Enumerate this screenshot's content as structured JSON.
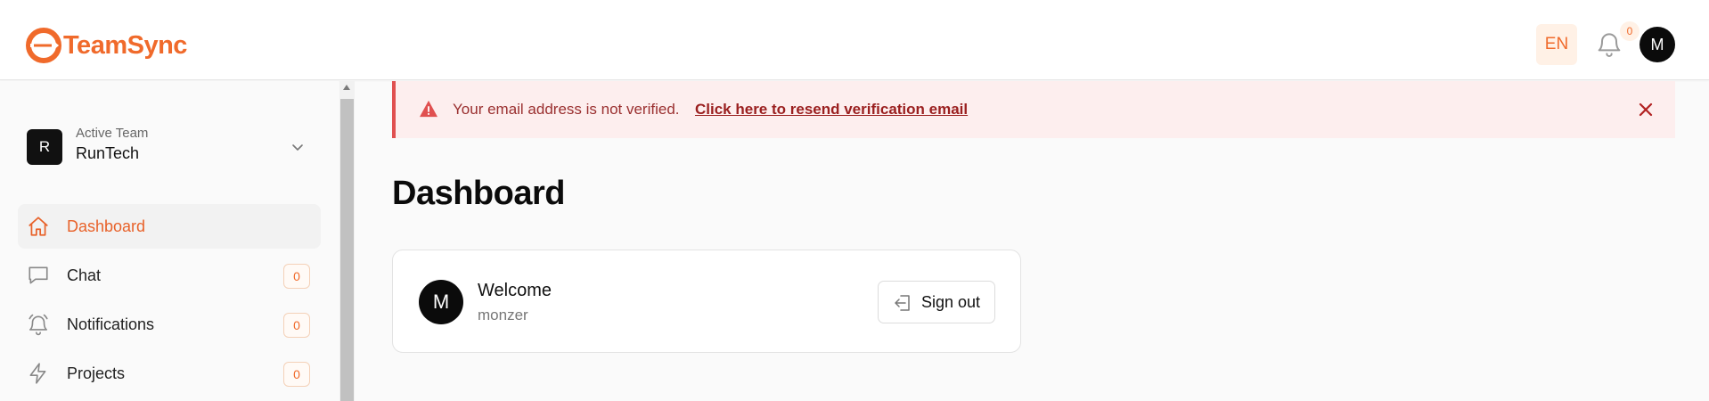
{
  "app": {
    "brand": "TeamSync",
    "accent_color": "#f06a2b"
  },
  "header": {
    "language": "EN",
    "notifications_count": "0",
    "user_initial": "M"
  },
  "sidebar": {
    "team": {
      "initial": "R",
      "caption": "Active Team",
      "name": "RunTech"
    },
    "items": [
      {
        "label": "Dashboard",
        "icon": "home-icon",
        "active": true
      },
      {
        "label": "Chat",
        "icon": "chat-icon",
        "count": "0"
      },
      {
        "label": "Notifications",
        "icon": "bell-icon",
        "count": "0"
      },
      {
        "label": "Projects",
        "icon": "lightning-icon",
        "count": "0"
      }
    ]
  },
  "alert": {
    "message": "Your email address is not verified.",
    "link": "Click here to resend verification email"
  },
  "main": {
    "title": "Dashboard",
    "welcome_card": {
      "avatar_initial": "M",
      "title": "Welcome",
      "username": "monzer",
      "signout_label": "Sign out"
    }
  }
}
